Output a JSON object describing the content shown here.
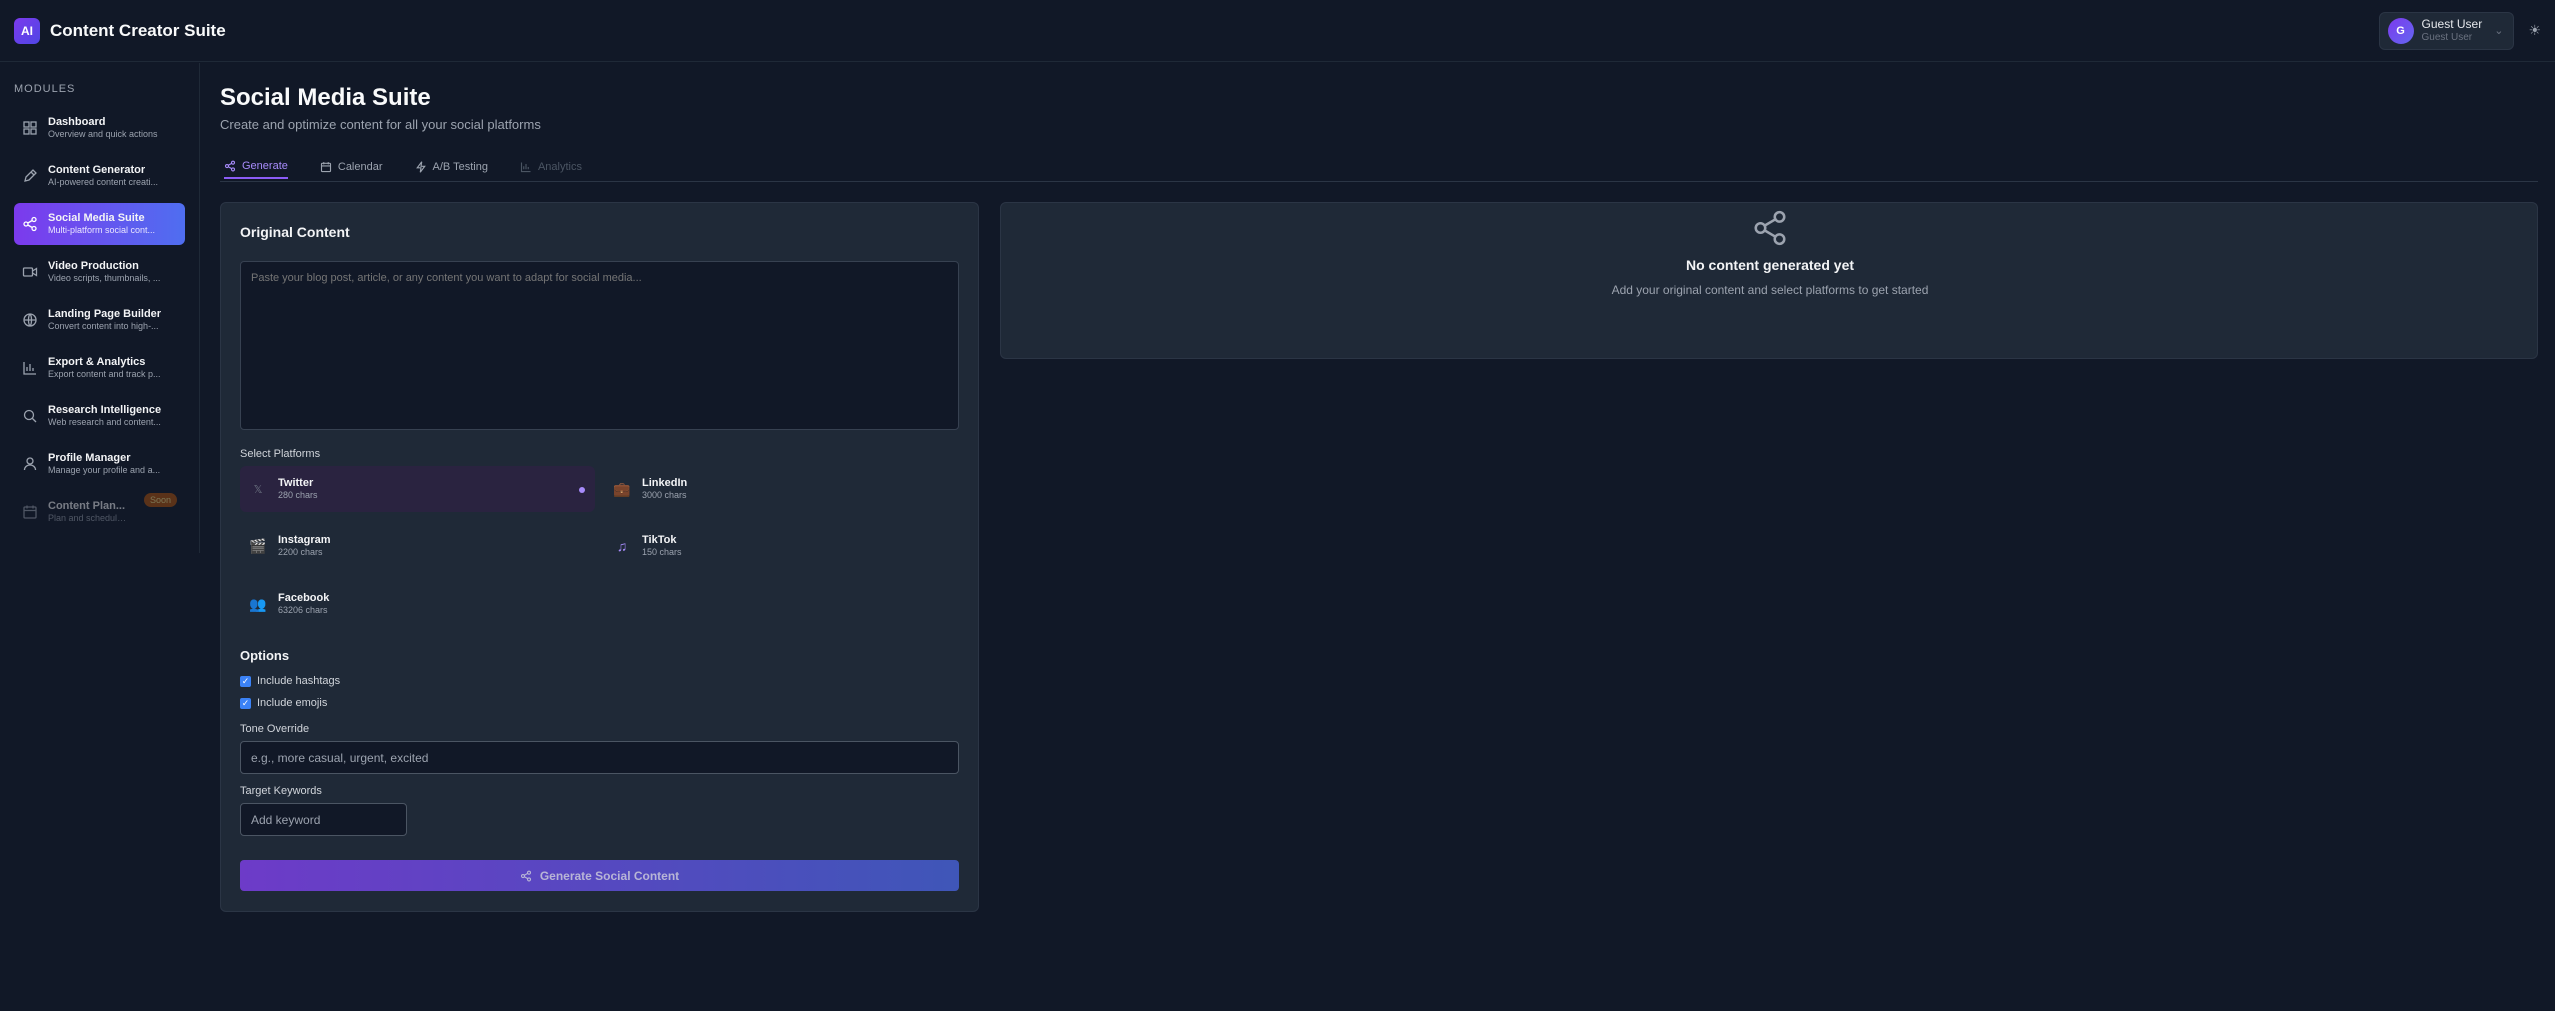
{
  "header": {
    "logo_text": "AI",
    "app_title": "Content Creator Suite",
    "user_name": "Guest User",
    "user_sub": "Guest User",
    "avatar_initial": "G"
  },
  "sidebar": {
    "heading": "MODULES",
    "items": [
      {
        "title": "Dashboard",
        "desc": "Overview and quick actions",
        "icon": "grid-icon"
      },
      {
        "title": "Content Generator",
        "desc": "AI-powered content creati...",
        "icon": "pen-icon"
      },
      {
        "title": "Social Media Suite",
        "desc": "Multi-platform social cont...",
        "icon": "share-icon"
      },
      {
        "title": "Video Production",
        "desc": "Video scripts, thumbnails, ...",
        "icon": "video-icon"
      },
      {
        "title": "Landing Page Builder",
        "desc": "Convert content into high-...",
        "icon": "globe-icon"
      },
      {
        "title": "Export & Analytics",
        "desc": "Export content and track p...",
        "icon": "bar-chart-icon"
      },
      {
        "title": "Research Intelligence",
        "desc": "Web research and content...",
        "icon": "search-icon"
      },
      {
        "title": "Profile Manager",
        "desc": "Manage your profile and a...",
        "icon": "user-icon"
      },
      {
        "title": "Content Plan...",
        "desc": "Plan and schedule your co...",
        "icon": "calendar-icon",
        "badge": "Soon"
      }
    ]
  },
  "main": {
    "title": "Social Media Suite",
    "subtitle": "Create and optimize content for all your social platforms",
    "tabs": [
      {
        "label": "Generate"
      },
      {
        "label": "Calendar"
      },
      {
        "label": "A/B Testing"
      },
      {
        "label": "Analytics"
      }
    ],
    "original_content_title": "Original Content",
    "textarea_placeholder": "Paste your blog post, article, or any content you want to adapt for social media...",
    "select_platforms_label": "Select Platforms",
    "platforms": [
      {
        "name": "Twitter",
        "count": "280 chars"
      },
      {
        "name": "LinkedIn",
        "count": "3000 chars"
      },
      {
        "name": "Instagram",
        "count": "2200 chars"
      },
      {
        "name": "TikTok",
        "count": "150 chars"
      },
      {
        "name": "Facebook",
        "count": "63206 chars"
      }
    ],
    "options_title": "Options",
    "option_hashtags": "Include hashtags",
    "option_emojis": "Include emojis",
    "tone_label": "Tone Override",
    "tone_placeholder": "e.g., more casual, urgent, excited",
    "keywords_label": "Target Keywords",
    "keyword_placeholder": "Add keyword",
    "generate_button": "Generate Social Content",
    "empty_title": "No content generated yet",
    "empty_sub": "Add your original content and select platforms to get started"
  },
  "colors": {
    "background": "#111827",
    "card": "#1f2937",
    "accent_purple": "#7c3aed",
    "accent_blue": "#4f6ef0"
  }
}
